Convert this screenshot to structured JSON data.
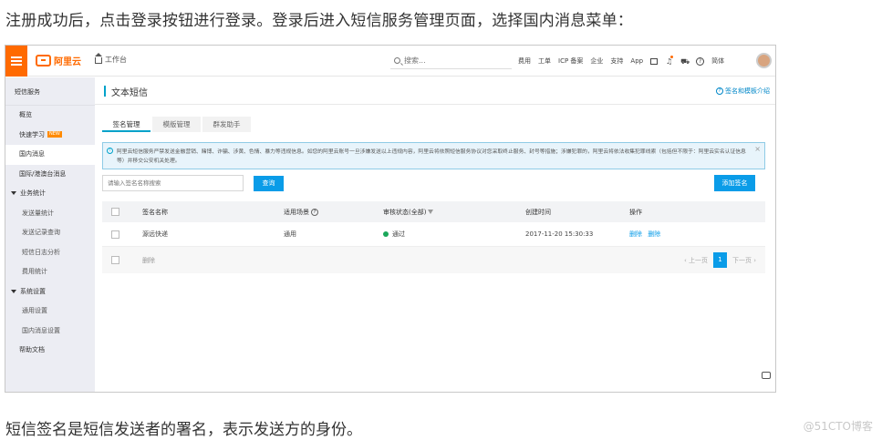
{
  "captions": {
    "top": "注册成功后，点击登录按钮进行登录。登录后进入短信服务管理页面，选择国内消息菜单：",
    "bottom": "短信签名是短信发送者的署名，表示发送方的身份。",
    "watermark": "@51CTO博客"
  },
  "topbar": {
    "logo_text": "阿里云",
    "workbench": "工作台",
    "search_placeholder": "搜索...",
    "links": [
      "费用",
      "工单",
      "ICP 备案",
      "企业",
      "支持",
      "App"
    ],
    "language": "简体",
    "accent": "#ff6a00"
  },
  "sidebar": {
    "title": "短信服务",
    "items": [
      {
        "label": "概览",
        "kind": "item"
      },
      {
        "label": "快速学习",
        "kind": "item",
        "badge": "NEW"
      },
      {
        "label": "国内消息",
        "kind": "item",
        "active": true
      },
      {
        "label": "国际/港澳台消息",
        "kind": "item"
      },
      {
        "label": "业务统计",
        "kind": "group"
      },
      {
        "label": "发送量统计",
        "kind": "sub"
      },
      {
        "label": "发送记录查询",
        "kind": "sub"
      },
      {
        "label": "短信日志分析",
        "kind": "sub"
      },
      {
        "label": "费用统计",
        "kind": "sub"
      },
      {
        "label": "系统设置",
        "kind": "group"
      },
      {
        "label": "通用设置",
        "kind": "sub"
      },
      {
        "label": "国内消息设置",
        "kind": "sub"
      },
      {
        "label": "帮助文档",
        "kind": "item"
      }
    ]
  },
  "main": {
    "title": "文本短信",
    "help_link": "签名和模板介绍",
    "tabs": [
      "签名管理",
      "模版管理",
      "群发助手"
    ],
    "notice": "阿里云短信服务严禁发送金融营销、赌博、诈骗、涉黄、色情、暴力等违规信息。如您的阿里云账号一旦涉嫌发送以上违规内容，阿里云将依照短信服务协议对您采取终止服务、封号等措施；涉嫌犯罪的，阿里云将依法收集犯罪线索（包括但不限于：阿里云实名认证信息等）并移交公安机关处理。",
    "search_placeholder": "请输入签名名称搜索",
    "query_button": "查询",
    "add_button": "添加签名",
    "table": {
      "columns": [
        "签名名称",
        "适用场景",
        "审核状态(全部)",
        "创建时间",
        "操作"
      ],
      "rows": [
        {
          "name": "源远快递",
          "scene": "通用",
          "status": "通过",
          "created": "2017-11-20 15:30:33",
          "ops": [
            "删除",
            "删除"
          ]
        }
      ],
      "footer_delete": "删除",
      "pager_prev": "上一页",
      "pager_current": "1",
      "pager_next": "下一页"
    }
  }
}
